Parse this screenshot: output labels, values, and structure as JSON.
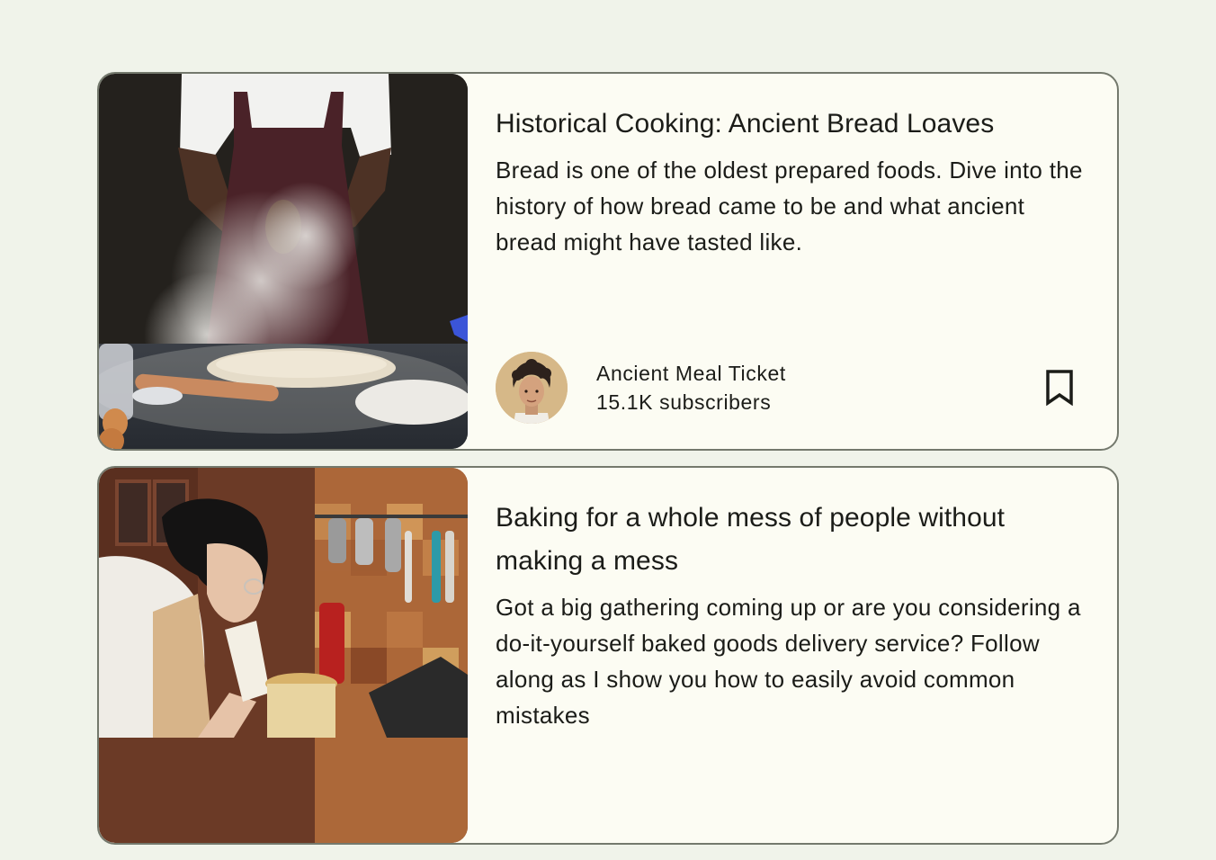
{
  "feed": {
    "cards": [
      {
        "title": "Historical Cooking: Ancient Bread Loaves",
        "description": "Bread is one of the oldest prepared foods. Dive into the history of how bread came to be and what ancient bread might have tasted like.",
        "channel": "Ancient Meal Ticket",
        "subscribers": "15.1K subscribers",
        "thumbnail_icon": "baker-flour-photo",
        "avatar_icon": "channel-avatar",
        "bookmark_icon": "bookmark-outline-icon"
      },
      {
        "title": "Baking for a whole mess of people without making a mess",
        "description": "Got a big gathering coming up or are you considering a do-it-yourself baked goods delivery service? Follow along as I show you how to easily avoid common mistakes",
        "thumbnail_icon": "piping-frosting-photo"
      }
    ]
  },
  "colors": {
    "background": "#f0f3ea",
    "card_surface": "#fcfcf3",
    "card_outline": "#74796d",
    "text": "#1b1c18"
  }
}
